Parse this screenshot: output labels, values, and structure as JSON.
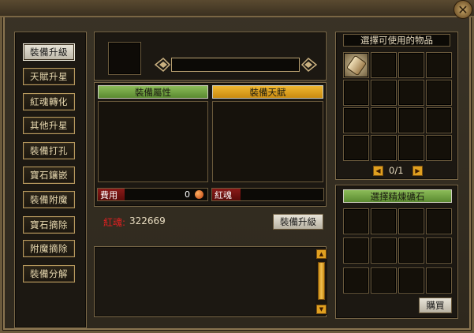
{
  "menu": {
    "items": [
      {
        "label": "裝備升級",
        "active": true
      },
      {
        "label": "天賦升星",
        "active": false
      },
      {
        "label": "紅魂轉化",
        "active": false
      },
      {
        "label": "其他升星",
        "active": false
      },
      {
        "label": "裝備打孔",
        "active": false
      },
      {
        "label": "寶石鑲嵌",
        "active": false
      },
      {
        "label": "裝備附魔",
        "active": false
      },
      {
        "label": "寶石摘除",
        "active": false
      },
      {
        "label": "附魔摘除",
        "active": false
      },
      {
        "label": "裝備分解",
        "active": false
      }
    ]
  },
  "center": {
    "tab_attr": "裝備屬性",
    "tab_talent": "裝備天賦",
    "fee_label": "費用",
    "fee_value": "0",
    "redsoul_bar_label": "紅魂",
    "redsoul_label": "紅魂:",
    "redsoul_value": "322669",
    "upgrade_button": "裝備升級"
  },
  "inventory": {
    "title": "選擇可使用的物品",
    "page": "0/1"
  },
  "refine": {
    "title": "選擇精煉礦石",
    "buy_button": "購買"
  },
  "colors": {
    "green_tab": "#6a9a3a",
    "orange_tab": "#e0a020",
    "red_text": "#e02020"
  }
}
